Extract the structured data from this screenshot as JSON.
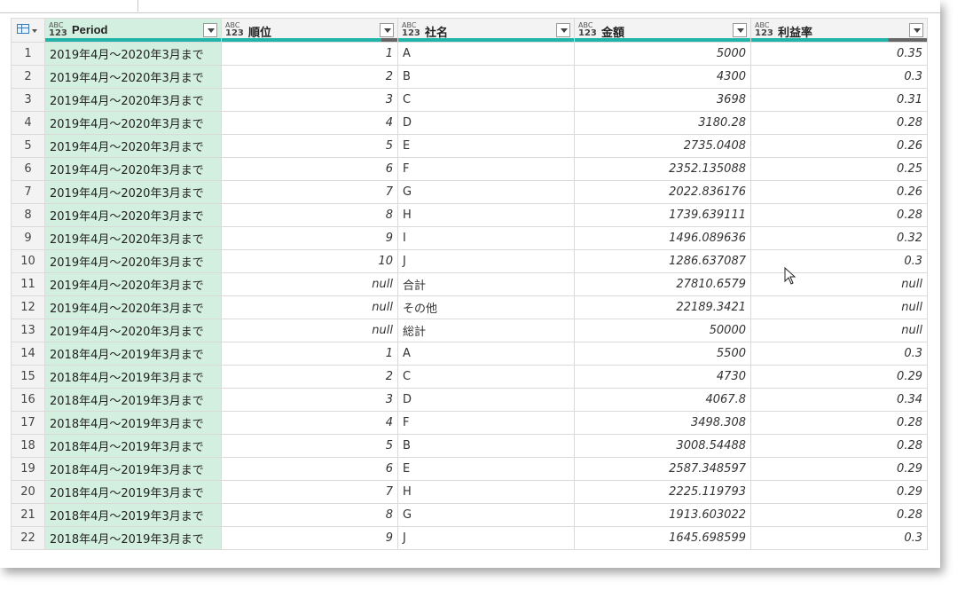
{
  "columns": [
    {
      "type_top": "ABC",
      "type_bottom": "123",
      "name": "Period"
    },
    {
      "type_top": "ABC",
      "type_bottom": "123",
      "name": "順位"
    },
    {
      "type_top": "ABC",
      "type_bottom": "123",
      "name": "社名"
    },
    {
      "type_top": "ABC",
      "type_bottom": "123",
      "name": "金額"
    },
    {
      "type_top": "ABC",
      "type_bottom": "123",
      "name": "利益率"
    }
  ],
  "rows": [
    {
      "n": "1",
      "period": "2019年4月～2020年3月まで",
      "rank": "1",
      "company": "A",
      "amount": "5000",
      "margin": "0.35"
    },
    {
      "n": "2",
      "period": "2019年4月～2020年3月まで",
      "rank": "2",
      "company": "B",
      "amount": "4300",
      "margin": "0.3"
    },
    {
      "n": "3",
      "period": "2019年4月～2020年3月まで",
      "rank": "3",
      "company": "C",
      "amount": "3698",
      "margin": "0.31"
    },
    {
      "n": "4",
      "period": "2019年4月～2020年3月まで",
      "rank": "4",
      "company": "D",
      "amount": "3180.28",
      "margin": "0.28"
    },
    {
      "n": "5",
      "period": "2019年4月～2020年3月まで",
      "rank": "5",
      "company": "E",
      "amount": "2735.0408",
      "margin": "0.26"
    },
    {
      "n": "6",
      "period": "2019年4月～2020年3月まで",
      "rank": "6",
      "company": "F",
      "amount": "2352.135088",
      "margin": "0.25"
    },
    {
      "n": "7",
      "period": "2019年4月～2020年3月まで",
      "rank": "7",
      "company": "G",
      "amount": "2022.836176",
      "margin": "0.26"
    },
    {
      "n": "8",
      "period": "2019年4月～2020年3月まで",
      "rank": "8",
      "company": "H",
      "amount": "1739.639111",
      "margin": "0.28"
    },
    {
      "n": "9",
      "period": "2019年4月～2020年3月まで",
      "rank": "9",
      "company": "I",
      "amount": "1496.089636",
      "margin": "0.32"
    },
    {
      "n": "10",
      "period": "2019年4月～2020年3月まで",
      "rank": "10",
      "company": "J",
      "amount": "1286.637087",
      "margin": "0.3"
    },
    {
      "n": "11",
      "period": "2019年4月～2020年3月まで",
      "rank": "null",
      "company": "合計",
      "amount": "27810.6579",
      "margin": "null"
    },
    {
      "n": "12",
      "period": "2019年4月～2020年3月まで",
      "rank": "null",
      "company": "その他",
      "amount": "22189.3421",
      "margin": "null"
    },
    {
      "n": "13",
      "period": "2019年4月～2020年3月まで",
      "rank": "null",
      "company": "総計",
      "amount": "50000",
      "margin": "null"
    },
    {
      "n": "14",
      "period": "2018年4月～2019年3月まで",
      "rank": "1",
      "company": "A",
      "amount": "5500",
      "margin": "0.3"
    },
    {
      "n": "15",
      "period": "2018年4月～2019年3月まで",
      "rank": "2",
      "company": "C",
      "amount": "4730",
      "margin": "0.29"
    },
    {
      "n": "16",
      "period": "2018年4月～2019年3月まで",
      "rank": "3",
      "company": "D",
      "amount": "4067.8",
      "margin": "0.34"
    },
    {
      "n": "17",
      "period": "2018年4月～2019年3月まで",
      "rank": "4",
      "company": "F",
      "amount": "3498.308",
      "margin": "0.28"
    },
    {
      "n": "18",
      "period": "2018年4月～2019年3月まで",
      "rank": "5",
      "company": "B",
      "amount": "3008.54488",
      "margin": "0.28"
    },
    {
      "n": "19",
      "period": "2018年4月～2019年3月まで",
      "rank": "6",
      "company": "E",
      "amount": "2587.348597",
      "margin": "0.29"
    },
    {
      "n": "20",
      "period": "2018年4月～2019年3月まで",
      "rank": "7",
      "company": "H",
      "amount": "2225.119793",
      "margin": "0.29"
    },
    {
      "n": "21",
      "period": "2018年4月～2019年3月まで",
      "rank": "8",
      "company": "G",
      "amount": "1913.603022",
      "margin": "0.28"
    },
    {
      "n": "22",
      "period": "2018年4月～2019年3月まで",
      "rank": "9",
      "company": "J",
      "amount": "1645.698599",
      "margin": "0.3"
    }
  ],
  "colors": {
    "selected_column": "#d3efe0",
    "quality_bar": "#21b5a9",
    "header_bg": "#f3f3f3"
  },
  "icons": {
    "table_menu": "table-icon",
    "column_type": "any-type-icon",
    "filter": "dropdown-icon",
    "pointer": "mouse-cursor-icon"
  }
}
